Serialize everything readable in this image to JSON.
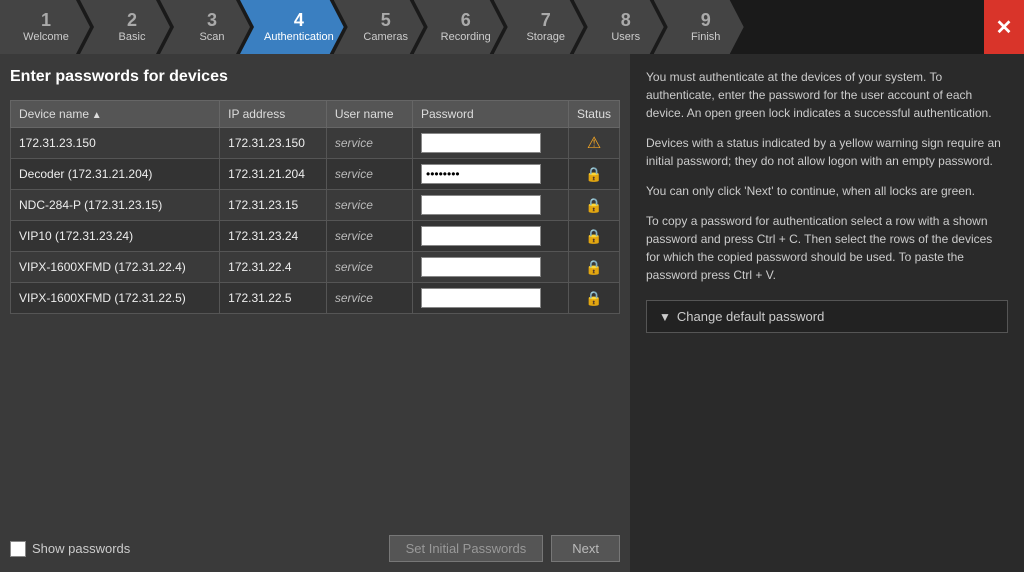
{
  "nav": {
    "items": [
      {
        "num": "1",
        "label": "Welcome",
        "active": false
      },
      {
        "num": "2",
        "label": "Basic",
        "active": false
      },
      {
        "num": "3",
        "label": "Scan",
        "active": false
      },
      {
        "num": "4",
        "label": "Authentication",
        "active": true
      },
      {
        "num": "5",
        "label": "Cameras",
        "active": false
      },
      {
        "num": "6",
        "label": "Recording",
        "active": false
      },
      {
        "num": "7",
        "label": "Storage",
        "active": false
      },
      {
        "num": "8",
        "label": "Users",
        "active": false
      },
      {
        "num": "9",
        "label": "Finish",
        "active": false
      }
    ],
    "close_label": "✕"
  },
  "left_panel": {
    "title": "Enter passwords for devices",
    "table": {
      "columns": [
        "Device name",
        "IP address",
        "User name",
        "Password",
        "Status"
      ],
      "rows": [
        {
          "device": "172.31.23.150",
          "ip": "172.31.23.150",
          "username": "service",
          "password": "",
          "status": "warning"
        },
        {
          "device": "Decoder (172.31.21.204)",
          "ip": "172.31.21.204",
          "username": "service",
          "password": "•••••••",
          "status": "lock"
        },
        {
          "device": "NDC-284-P (172.31.23.15)",
          "ip": "172.31.23.15",
          "username": "service",
          "password": "",
          "status": "lock"
        },
        {
          "device": "VIP10 (172.31.23.24)",
          "ip": "172.31.23.24",
          "username": "service",
          "password": "",
          "status": "lock"
        },
        {
          "device": "VIPX-1600XFMD (172.31.22.4)",
          "ip": "172.31.22.4",
          "username": "service",
          "password": "",
          "status": "lock"
        },
        {
          "device": "VIPX-1600XFMD (172.31.22.5)",
          "ip": "172.31.22.5",
          "username": "service",
          "password": "",
          "status": "lock"
        }
      ]
    },
    "show_passwords_label": "Show passwords",
    "set_initial_btn": "Set Initial Passwords",
    "next_btn": "Next"
  },
  "right_panel": {
    "help_text_1": "You must authenticate at the devices of your system. To authenticate, enter the password for the user account of each device. An open green lock indicates a successful authentication.",
    "help_text_2": "Devices with a status indicated by a yellow warning sign require an initial password; they do not allow logon with an empty password.",
    "help_text_3": "You can only click 'Next' to continue, when all locks are green.",
    "help_text_4": "To copy a password for authentication select a row with a shown password and press Ctrl + C. Then select the rows of the devices for which the copied password should be used. To paste the password press Ctrl + V.",
    "change_password_btn": "Change default password"
  }
}
